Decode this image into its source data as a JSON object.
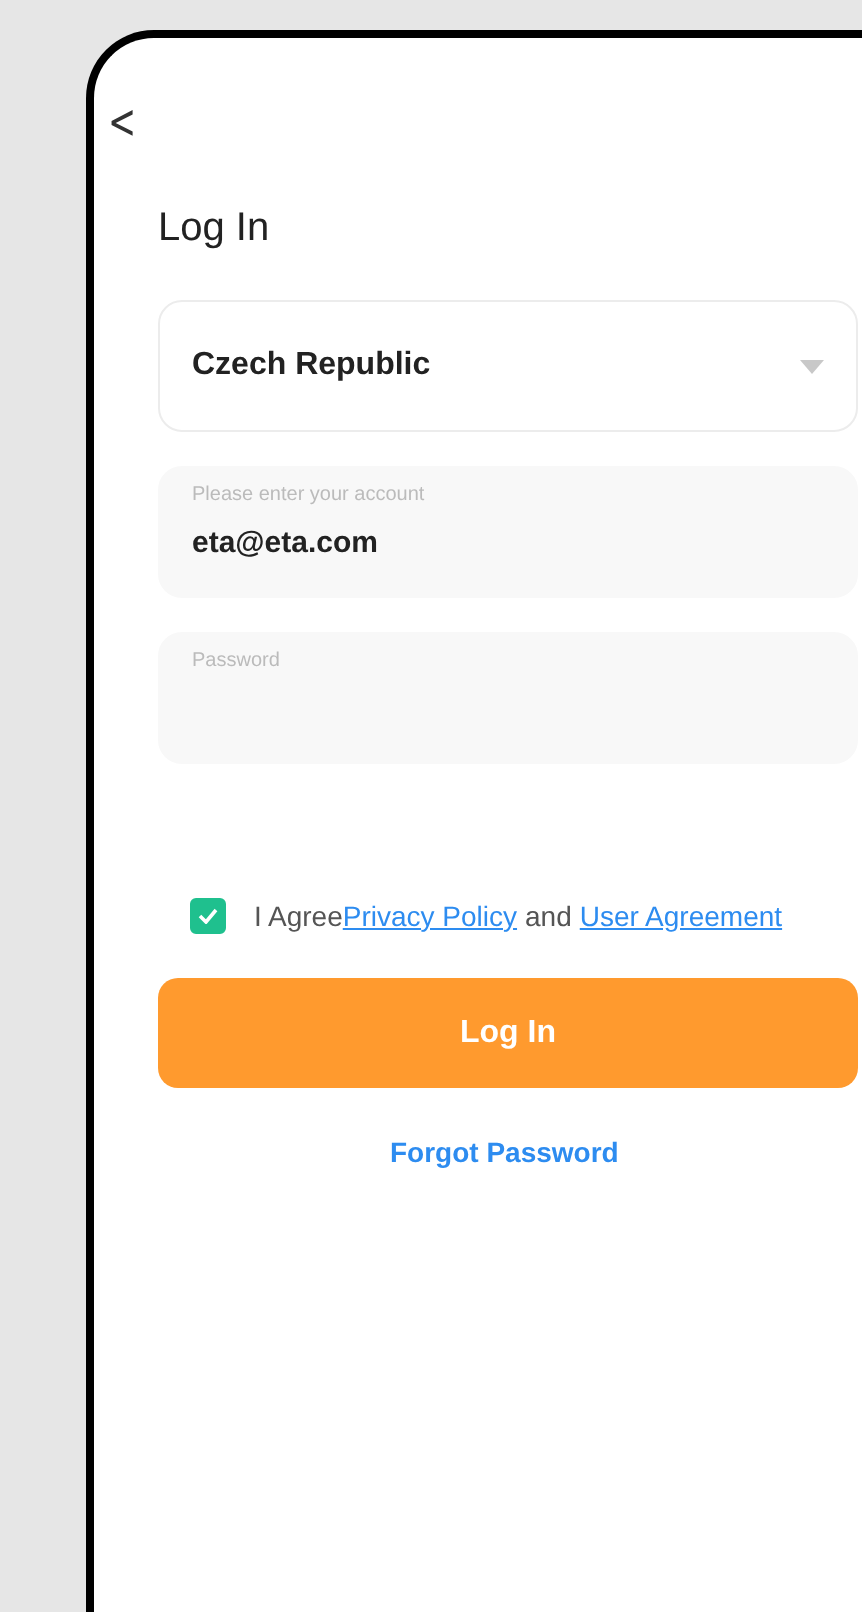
{
  "screen": {
    "back": "<",
    "title": "Log In"
  },
  "region": {
    "value": "Czech Republic"
  },
  "account": {
    "placeholder": "Please enter your account",
    "value": "eta@eta.com"
  },
  "password": {
    "placeholder": "Password"
  },
  "agreement": {
    "checked": true,
    "parts": [
      {
        "kind": "text",
        "text": "I Agree"
      },
      {
        "kind": "link",
        "text": "Privacy Policy"
      },
      {
        "kind": "text",
        "text": "and"
      },
      {
        "kind": "link",
        "text": "User Agreement"
      }
    ]
  },
  "login_button": "Log In",
  "forgot_link": "Forgot Password"
}
